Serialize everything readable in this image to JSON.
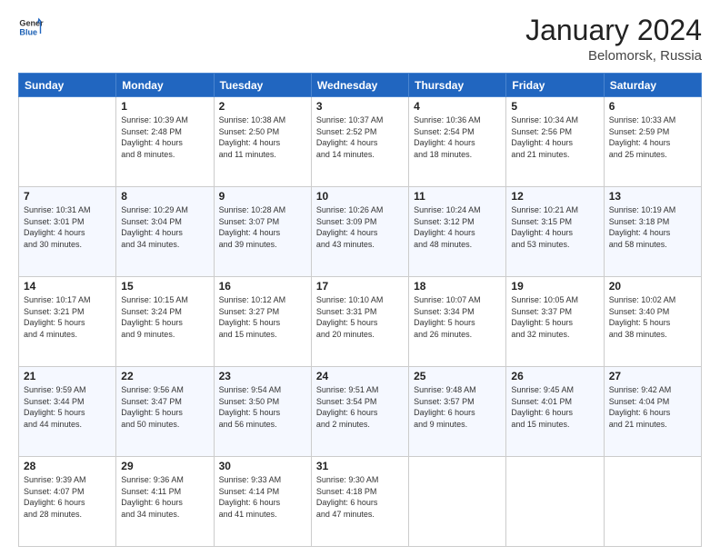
{
  "header": {
    "logo_general": "General",
    "logo_blue": "Blue",
    "title": "January 2024",
    "location": "Belomorsk, Russia"
  },
  "days_of_week": [
    "Sunday",
    "Monday",
    "Tuesday",
    "Wednesday",
    "Thursday",
    "Friday",
    "Saturday"
  ],
  "weeks": [
    [
      {
        "day": "",
        "info": ""
      },
      {
        "day": "1",
        "info": "Sunrise: 10:39 AM\nSunset: 2:48 PM\nDaylight: 4 hours\nand 8 minutes."
      },
      {
        "day": "2",
        "info": "Sunrise: 10:38 AM\nSunset: 2:50 PM\nDaylight: 4 hours\nand 11 minutes."
      },
      {
        "day": "3",
        "info": "Sunrise: 10:37 AM\nSunset: 2:52 PM\nDaylight: 4 hours\nand 14 minutes."
      },
      {
        "day": "4",
        "info": "Sunrise: 10:36 AM\nSunset: 2:54 PM\nDaylight: 4 hours\nand 18 minutes."
      },
      {
        "day": "5",
        "info": "Sunrise: 10:34 AM\nSunset: 2:56 PM\nDaylight: 4 hours\nand 21 minutes."
      },
      {
        "day": "6",
        "info": "Sunrise: 10:33 AM\nSunset: 2:59 PM\nDaylight: 4 hours\nand 25 minutes."
      }
    ],
    [
      {
        "day": "7",
        "info": "Sunrise: 10:31 AM\nSunset: 3:01 PM\nDaylight: 4 hours\nand 30 minutes."
      },
      {
        "day": "8",
        "info": "Sunrise: 10:29 AM\nSunset: 3:04 PM\nDaylight: 4 hours\nand 34 minutes."
      },
      {
        "day": "9",
        "info": "Sunrise: 10:28 AM\nSunset: 3:07 PM\nDaylight: 4 hours\nand 39 minutes."
      },
      {
        "day": "10",
        "info": "Sunrise: 10:26 AM\nSunset: 3:09 PM\nDaylight: 4 hours\nand 43 minutes."
      },
      {
        "day": "11",
        "info": "Sunrise: 10:24 AM\nSunset: 3:12 PM\nDaylight: 4 hours\nand 48 minutes."
      },
      {
        "day": "12",
        "info": "Sunrise: 10:21 AM\nSunset: 3:15 PM\nDaylight: 4 hours\nand 53 minutes."
      },
      {
        "day": "13",
        "info": "Sunrise: 10:19 AM\nSunset: 3:18 PM\nDaylight: 4 hours\nand 58 minutes."
      }
    ],
    [
      {
        "day": "14",
        "info": "Sunrise: 10:17 AM\nSunset: 3:21 PM\nDaylight: 5 hours\nand 4 minutes."
      },
      {
        "day": "15",
        "info": "Sunrise: 10:15 AM\nSunset: 3:24 PM\nDaylight: 5 hours\nand 9 minutes."
      },
      {
        "day": "16",
        "info": "Sunrise: 10:12 AM\nSunset: 3:27 PM\nDaylight: 5 hours\nand 15 minutes."
      },
      {
        "day": "17",
        "info": "Sunrise: 10:10 AM\nSunset: 3:31 PM\nDaylight: 5 hours\nand 20 minutes."
      },
      {
        "day": "18",
        "info": "Sunrise: 10:07 AM\nSunset: 3:34 PM\nDaylight: 5 hours\nand 26 minutes."
      },
      {
        "day": "19",
        "info": "Sunrise: 10:05 AM\nSunset: 3:37 PM\nDaylight: 5 hours\nand 32 minutes."
      },
      {
        "day": "20",
        "info": "Sunrise: 10:02 AM\nSunset: 3:40 PM\nDaylight: 5 hours\nand 38 minutes."
      }
    ],
    [
      {
        "day": "21",
        "info": "Sunrise: 9:59 AM\nSunset: 3:44 PM\nDaylight: 5 hours\nand 44 minutes."
      },
      {
        "day": "22",
        "info": "Sunrise: 9:56 AM\nSunset: 3:47 PM\nDaylight: 5 hours\nand 50 minutes."
      },
      {
        "day": "23",
        "info": "Sunrise: 9:54 AM\nSunset: 3:50 PM\nDaylight: 5 hours\nand 56 minutes."
      },
      {
        "day": "24",
        "info": "Sunrise: 9:51 AM\nSunset: 3:54 PM\nDaylight: 6 hours\nand 2 minutes."
      },
      {
        "day": "25",
        "info": "Sunrise: 9:48 AM\nSunset: 3:57 PM\nDaylight: 6 hours\nand 9 minutes."
      },
      {
        "day": "26",
        "info": "Sunrise: 9:45 AM\nSunset: 4:01 PM\nDaylight: 6 hours\nand 15 minutes."
      },
      {
        "day": "27",
        "info": "Sunrise: 9:42 AM\nSunset: 4:04 PM\nDaylight: 6 hours\nand 21 minutes."
      }
    ],
    [
      {
        "day": "28",
        "info": "Sunrise: 9:39 AM\nSunset: 4:07 PM\nDaylight: 6 hours\nand 28 minutes."
      },
      {
        "day": "29",
        "info": "Sunrise: 9:36 AM\nSunset: 4:11 PM\nDaylight: 6 hours\nand 34 minutes."
      },
      {
        "day": "30",
        "info": "Sunrise: 9:33 AM\nSunset: 4:14 PM\nDaylight: 6 hours\nand 41 minutes."
      },
      {
        "day": "31",
        "info": "Sunrise: 9:30 AM\nSunset: 4:18 PM\nDaylight: 6 hours\nand 47 minutes."
      },
      {
        "day": "",
        "info": ""
      },
      {
        "day": "",
        "info": ""
      },
      {
        "day": "",
        "info": ""
      }
    ]
  ]
}
